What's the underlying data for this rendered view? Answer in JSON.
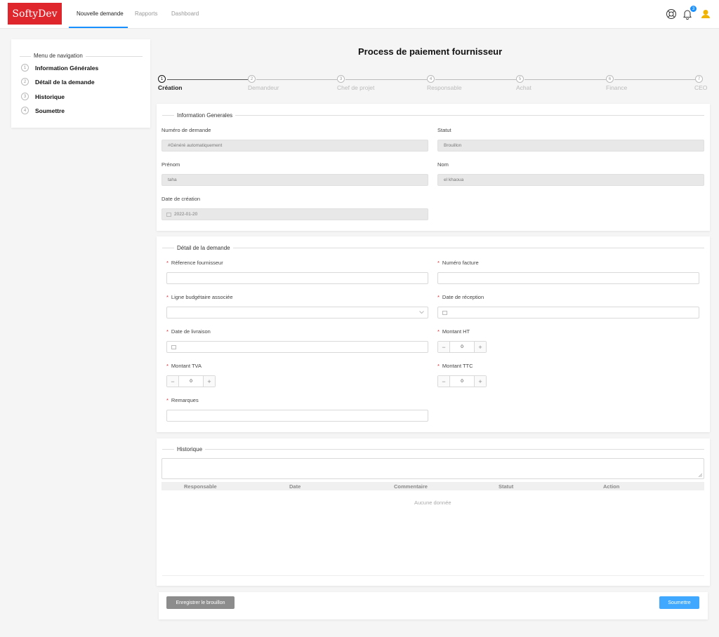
{
  "header": {
    "logo": "SoftyDev",
    "tabs": [
      "Nouvelle demande",
      "Rapports",
      "Dashboard"
    ],
    "notification_count": "3",
    "icons": [
      "support-icon",
      "bell-icon",
      "user-icon"
    ],
    "accent_color": "#1890ff",
    "brand_color": "#e0262d"
  },
  "sidebar": {
    "title": "Menu de navigation",
    "items": [
      {
        "num": "1",
        "label": "Information Générales"
      },
      {
        "num": "2",
        "label": "Détail de la demande"
      },
      {
        "num": "3",
        "label": "Historique"
      },
      {
        "num": "4",
        "label": "Soumettre"
      }
    ]
  },
  "page": {
    "title": "Process de paiement fournisseur"
  },
  "steps": [
    {
      "num": "1",
      "label": "Création"
    },
    {
      "num": "2",
      "label": "Demandeur"
    },
    {
      "num": "3",
      "label": "Chef de projet"
    },
    {
      "num": "4",
      "label": "Responsable"
    },
    {
      "num": "5",
      "label": "Achat"
    },
    {
      "num": "6",
      "label": "Finance"
    },
    {
      "num": "7",
      "label": "CEO"
    }
  ],
  "info": {
    "legend": "Information Generales",
    "numero_label": "Numéro de demande",
    "numero_value": "#Généré automatiquement",
    "statut_label": "Statut",
    "statut_value": "Brouillon",
    "prenom_label": "Prénom",
    "prenom_value": "taha",
    "nom_label": "Nom",
    "nom_value": "el khaoua",
    "date_label": "Date de création",
    "date_value": "2022-01-20"
  },
  "detail": {
    "legend": "Détail de la demande",
    "ref_label": "Réference fournisseur",
    "facture_label": "Numéro facture",
    "ligne_label": "Ligne budgétaire associée",
    "reception_label": "Date de réception",
    "livraison_label": "Date de livraison",
    "ht_label": "Montant HT",
    "ht_value": "0",
    "tva_label": "Montant TVA",
    "tva_value": "0",
    "ttc_label": "Montant TTC",
    "ttc_value": "0",
    "remarques_label": "Remarques"
  },
  "historique": {
    "legend": "Historique",
    "columns": [
      "Responsable",
      "Date",
      "Commentaire",
      "Statut",
      "Action"
    ],
    "empty": "Aucune donnée"
  },
  "footer": {
    "draft_button": "Enregistrer le brouillon",
    "submit_button": "Soumettre"
  }
}
